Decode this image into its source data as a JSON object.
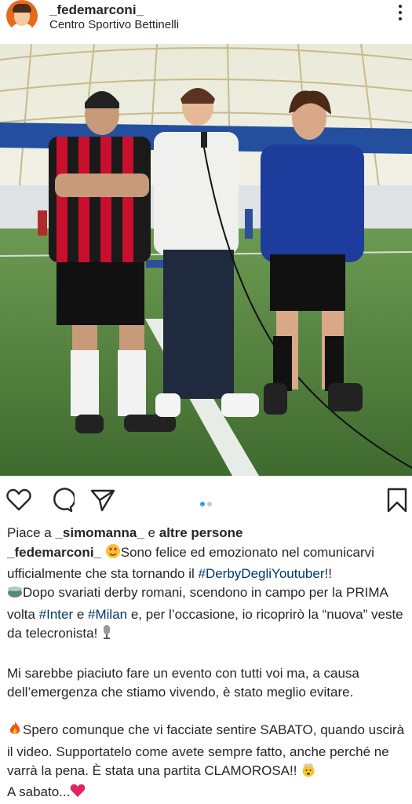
{
  "post": {
    "username": "_fedemarconi_",
    "location": "Centro Sportivo Bettinelli"
  },
  "likes": {
    "prefix": "Piace a ",
    "user": "_simomanna_",
    "middle": " e ",
    "others": "altre persone"
  },
  "caption": {
    "author": "_fedemarconi_",
    "line1_text": "Sono felice ed emozionato nel comunicarvi ufficialmente che sta tornando il ",
    "hashtag_derby": "#DerbyDegliYoutuber",
    "line1_end": "!!",
    "p2_text_a": "Dopo svariati derby romani, scendono in campo per la PRIMA volta ",
    "hashtag_inter": "#Inter",
    "p2_and": " e ",
    "hashtag_milan": "#Milan",
    "p2_text_b": " e, per l’occasione, io ricoprirò la “nuova” veste da telecronista! ",
    "p3": "Mi sarebbe piaciuto fare un evento con tutti voi ma, a causa dell’emergenza che stiamo vivendo, è stato meglio evitare.",
    "p4_text": "Spero comunque che vi facciate sentire SABATO, quando uscirà il video. Supportatelo come avete sempre fatto, anche perché ne varrà la pena. È stata una partita CLAMOROSA!! ",
    "p5_text": "A sabato..."
  },
  "carousel": {
    "count": 2,
    "active": 1
  },
  "icons": {
    "more": "more-vertical-icon",
    "like": "heart-icon",
    "comment": "comment-icon",
    "share": "share-icon",
    "save": "bookmark-icon"
  },
  "colors": {
    "hashtag": "#00376b",
    "dot_active": "#3897f0",
    "dot_inactive": "#c7c7c7",
    "avatar_bg": "#e86a1c"
  }
}
